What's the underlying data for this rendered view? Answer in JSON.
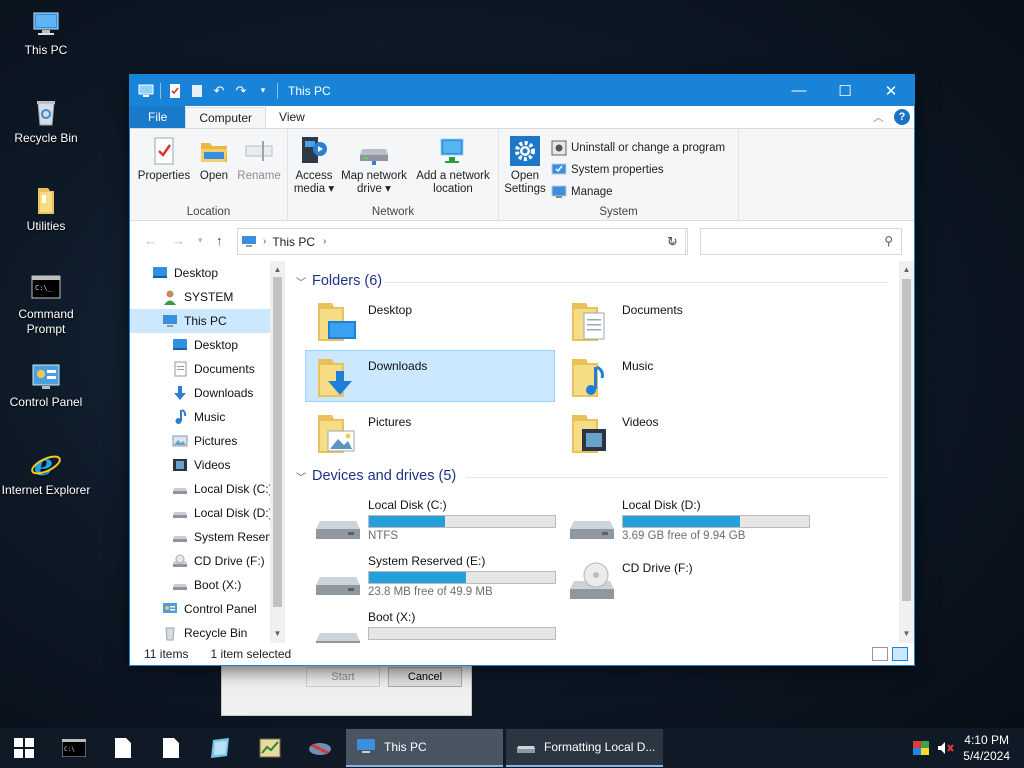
{
  "desktop": {
    "icons": [
      {
        "label": "This PC"
      },
      {
        "label": "Recycle Bin"
      },
      {
        "label": "Utilities"
      },
      {
        "label": "Command Prompt"
      },
      {
        "label": "Control Panel"
      },
      {
        "label": "Internet Explorer"
      }
    ]
  },
  "background_dialog": {
    "start_label": "Start",
    "cancel_label": "Cancel"
  },
  "window": {
    "title": "This PC",
    "tabs": [
      {
        "label": "File"
      },
      {
        "label": "Computer"
      },
      {
        "label": "View"
      }
    ],
    "ribbon": {
      "location": {
        "name": "Location",
        "properties": "Properties",
        "open": "Open",
        "rename": "Rename"
      },
      "network": {
        "name": "Network",
        "access_media_1": "Access",
        "access_media_2": "media",
        "map_drive_1": "Map network",
        "map_drive_2": "drive",
        "add_location_1": "Add a network",
        "add_location_2": "location"
      },
      "system": {
        "name": "System",
        "open_settings_1": "Open",
        "open_settings_2": "Settings",
        "uninstall": "Uninstall or change a program",
        "system_properties": "System properties",
        "manage": "Manage"
      }
    },
    "address": {
      "path": "This PC",
      "search_placeholder": ""
    },
    "nav": [
      {
        "label": "Desktop",
        "icon": "desktop-icon"
      },
      {
        "label": "SYSTEM",
        "icon": "user-icon"
      },
      {
        "label": "This PC",
        "icon": "pc-icon"
      },
      {
        "label": "Desktop",
        "icon": "desktop-icon"
      },
      {
        "label": "Documents",
        "icon": "documents-icon"
      },
      {
        "label": "Downloads",
        "icon": "downloads-icon"
      },
      {
        "label": "Music",
        "icon": "music-icon"
      },
      {
        "label": "Pictures",
        "icon": "pictures-icon"
      },
      {
        "label": "Videos",
        "icon": "videos-icon"
      },
      {
        "label": "Local Disk (C:)",
        "icon": "drive-icon"
      },
      {
        "label": "Local Disk (D:)",
        "icon": "drive-icon"
      },
      {
        "label": "System Reserve",
        "icon": "drive-icon"
      },
      {
        "label": "CD Drive (F:)",
        "icon": "cd-icon"
      },
      {
        "label": "Boot (X:)",
        "icon": "drive-icon"
      },
      {
        "label": "Control Panel",
        "icon": "control-panel-icon"
      },
      {
        "label": "Recycle Bin",
        "icon": "recycle-icon"
      }
    ],
    "folders_header": "Folders (6)",
    "folders": [
      {
        "name": "Desktop"
      },
      {
        "name": "Documents"
      },
      {
        "name": "Downloads"
      },
      {
        "name": "Music"
      },
      {
        "name": "Pictures"
      },
      {
        "name": "Videos"
      }
    ],
    "devices_header": "Devices and drives (5)",
    "drives": [
      {
        "name": "Local Disk (C:)",
        "detail": "NTFS",
        "used_fraction": 0.41
      },
      {
        "name": "Local Disk (D:)",
        "detail": "3.69 GB free of 9.94 GB",
        "used_fraction": 0.63
      },
      {
        "name": "System Reserved (E:)",
        "detail": "23.8 MB free of 49.9 MB",
        "used_fraction": 0.52
      },
      {
        "name": "CD Drive (F:)",
        "detail": ""
      },
      {
        "name": "Boot (X:)",
        "detail": "",
        "used_fraction": 0.0
      }
    ],
    "status": {
      "items": "11 items",
      "selected": "1 item selected"
    }
  },
  "taskbar": {
    "this_pc": "This PC",
    "formatting": "Formatting Local D...",
    "time": "4:10 PM",
    "date": "5/4/2024"
  },
  "colors": {
    "accent": "#1883d7",
    "selection": "#cce8ff",
    "drive_bar": "#26a0da"
  }
}
